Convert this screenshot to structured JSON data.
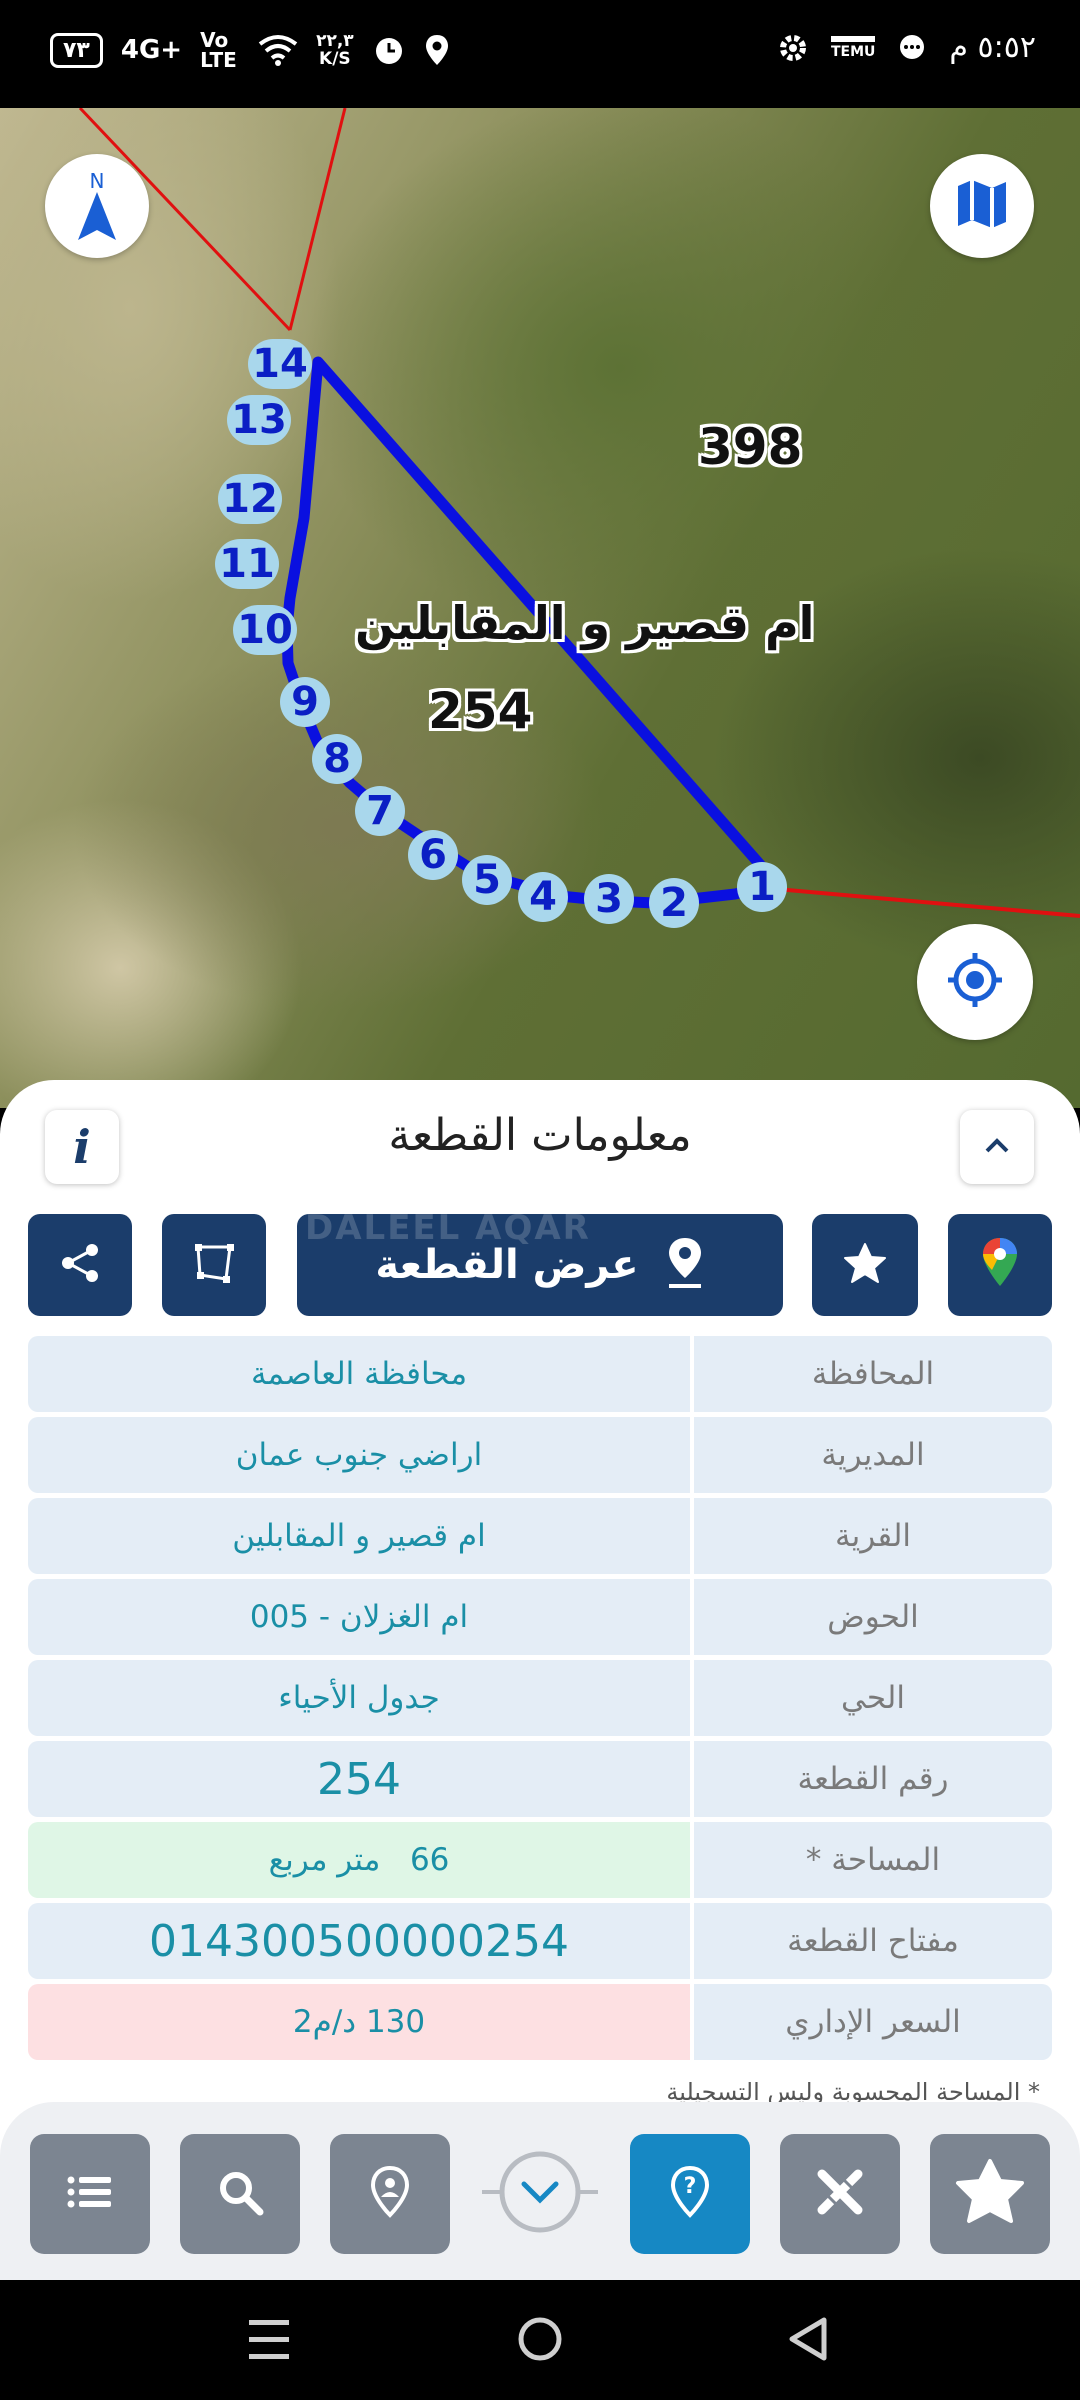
{
  "status_bar": {
    "battery": "٧٣",
    "network": "4G+",
    "volte": "Vo LTE",
    "speed": "٢٢,٣",
    "speed_unit": "K/S",
    "time": "٥:٥٢ م",
    "temu_label": "TEMU"
  },
  "map": {
    "north_label": "N",
    "parcel_number": "254",
    "neighbor_parcel": "398",
    "village_label": "ام قصير و المقابلين",
    "points": [
      "1",
      "2",
      "3",
      "4",
      "5",
      "6",
      "7",
      "8",
      "9",
      "10",
      "11",
      "12",
      "13",
      "14"
    ]
  },
  "panel": {
    "title": "معلومات القطعة",
    "info_icon": "i",
    "view_parcel_button": "عرض القطعة",
    "watermark": "DALEEL AQAR",
    "rows": [
      {
        "label": "المحافظة",
        "value": "محافظة العاصمة"
      },
      {
        "label": "المديرية",
        "value": "اراضي جنوب عمان"
      },
      {
        "label": "القرية",
        "value": "ام قصير و المقابلين"
      },
      {
        "label": "الحوض",
        "value": "ام الغزلان - 005"
      },
      {
        "label": "الحي",
        "value": "جدول الأحياء"
      },
      {
        "label": "رقم القطعة",
        "value": "254"
      },
      {
        "label": "المساحة *",
        "value": "66   متر مربع"
      },
      {
        "label": "مفتاح القطعة",
        "value": "014300500000254"
      },
      {
        "label": "السعر الإداري",
        "value": "130 د/م2"
      }
    ],
    "footnote": "* المساحة المحسوبة وليس التسجيلية"
  },
  "colors": {
    "dark_button": "#1b3d6b",
    "active_nav": "#1688c4",
    "parcel_outline": "#0a10e0",
    "boundary_red": "#e01010"
  }
}
